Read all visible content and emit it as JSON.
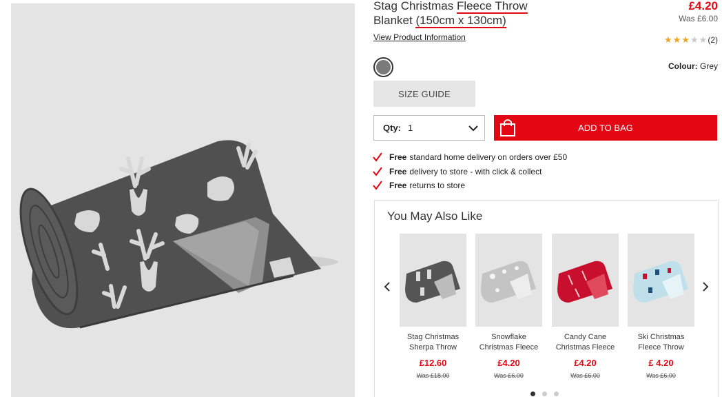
{
  "product": {
    "title_part1": "Stag Christmas ",
    "title_part2": "Fleece Throw",
    "title_part3": "Blanket ",
    "title_part4": "(150cm x 130cm)",
    "price_now": "£4.20",
    "price_was": "Was £6.00",
    "view_info_label": "View Product Information",
    "rating_stars": 3,
    "rating_max": 5,
    "rating_count": "(2)",
    "colour_label": "Colour:",
    "colour_value": "Grey",
    "size_guide_label": "SIZE GUIDE",
    "qty_label": "Qty:",
    "qty_value": "1",
    "add_to_bag_label": "ADD TO BAG",
    "brand_color": "#e30613"
  },
  "benefits": [
    {
      "bold": "Free",
      "text": "standard home delivery on orders over £50"
    },
    {
      "bold": "Free",
      "text": "delivery to store - with click & collect"
    },
    {
      "bold": "Free",
      "text": "returns to store"
    }
  ],
  "you_may_also_like": {
    "title": "You May Also Like",
    "items": [
      {
        "name_line1": "Stag Christmas",
        "name_line2": "Sherpa Throw",
        "price": "£12.60",
        "was": "Was £18.00",
        "thumb": "stag-grey"
      },
      {
        "name_line1": "Snowflake",
        "name_line2": "Christmas Fleece",
        "price": "£4.20",
        "was": "Was £6.00",
        "thumb": "snowflake-light-grey"
      },
      {
        "name_line1": "Candy Cane",
        "name_line2": "Christmas Fleece",
        "price": "£4.20",
        "was": "Was £6.00",
        "thumb": "candy-cane-red"
      },
      {
        "name_line1": "Ski Christmas",
        "name_line2": "Fleece Throw",
        "price": "£ 4.20",
        "was": "Was £6.00",
        "thumb": "ski-light-blue"
      }
    ],
    "page_count": 3,
    "active_page": 1
  }
}
